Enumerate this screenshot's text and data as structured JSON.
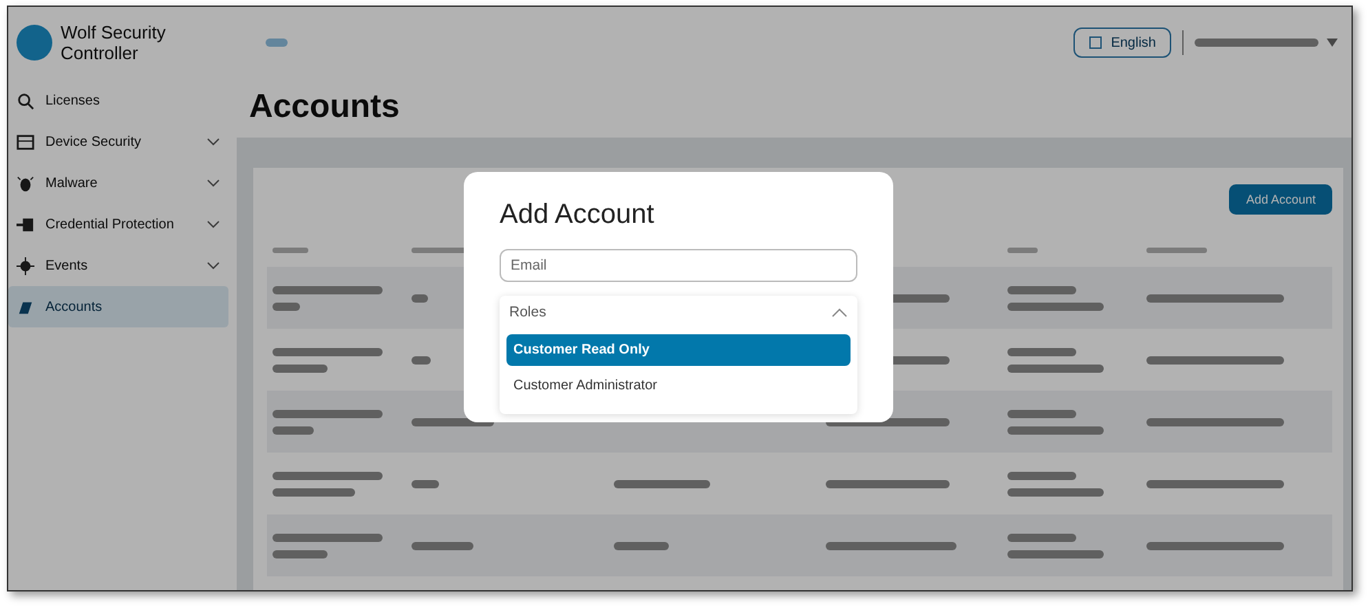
{
  "app": {
    "title": "Wolf Security Controller",
    "language": "English"
  },
  "sidebar": {
    "items": [
      {
        "label": "Licenses",
        "expandable": false,
        "selected": false
      },
      {
        "label": "Device Security",
        "expandable": true,
        "selected": false
      },
      {
        "label": "Malware",
        "expandable": true,
        "selected": false
      },
      {
        "label": "Credential Protection",
        "expandable": true,
        "selected": false
      },
      {
        "label": "Events",
        "expandable": true,
        "selected": false
      },
      {
        "label": "Accounts",
        "expandable": false,
        "selected": true
      }
    ]
  },
  "page_title": "Accounts",
  "add_button": "Add Account",
  "dialog": {
    "title": "Add Account",
    "email": {
      "placeholder": "Email"
    },
    "roles": {
      "placeholder": "Roles",
      "expanded": true,
      "options": [
        {
          "label": "Customer Read Only",
          "selected": true
        },
        {
          "label": "Customer Administrator",
          "selected": false
        }
      ]
    }
  }
}
